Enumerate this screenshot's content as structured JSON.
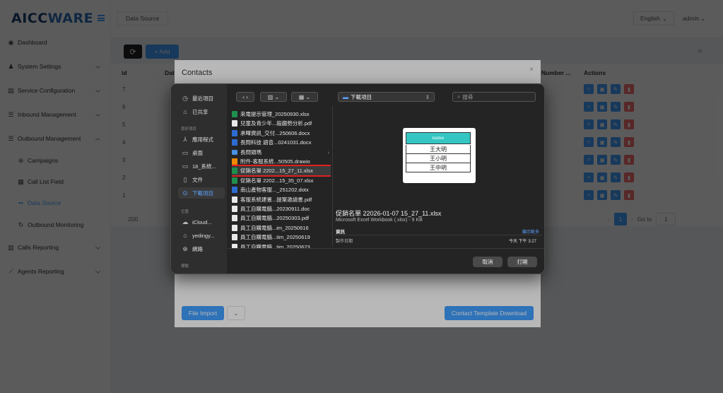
{
  "app": {
    "logo_prefix": "AICC",
    "logo_suffix": "WARE"
  },
  "sidebar": {
    "items": [
      {
        "label": "Dashboard",
        "icon": "dashboard-icon"
      },
      {
        "label": "System Settings",
        "icon": "users-icon"
      },
      {
        "label": "Service Configuration",
        "icon": "config-icon"
      },
      {
        "label": "Inbound Management",
        "icon": "inbound-icon"
      },
      {
        "label": "Outbound Management",
        "icon": "outbound-icon"
      },
      {
        "label": "Campaigns",
        "icon": "campaign-icon"
      },
      {
        "label": "Call List Field",
        "icon": "list-icon"
      },
      {
        "label": "Data Source",
        "icon": "grid-icon"
      },
      {
        "label": "Outbound Monitoring",
        "icon": "monitor-icon"
      },
      {
        "label": "Calls Reporting",
        "icon": "bar-chart-icon"
      },
      {
        "label": "Agents Reporting",
        "icon": "line-chart-icon"
      }
    ]
  },
  "header": {
    "breadcrumb_tag": "Data Source",
    "language": "English",
    "user": "admin"
  },
  "toolbar": {
    "add_label": "+ Add",
    "refresh_icon": "⟳"
  },
  "table": {
    "columns": [
      "id",
      "Dat",
      "Number ...",
      "Actions"
    ],
    "ids": [
      "7",
      "6",
      "5",
      "4",
      "3",
      "2",
      "1"
    ],
    "total": "200"
  },
  "pagination": {
    "current": "1",
    "goto_label": "Go to",
    "goto_value": "1"
  },
  "modal": {
    "title": "Contacts",
    "import_label": "File Import",
    "template_label": "Contact Template Download"
  },
  "picker": {
    "sidebar": {
      "favorites": [
        {
          "label": "最近項目",
          "icon": "clock-icon"
        },
        {
          "label": "已共享",
          "icon": "shared-folder-icon"
        }
      ],
      "heading_favorites": "喜好項目",
      "places": [
        {
          "label": "應用程式",
          "icon": "apps-icon"
        },
        {
          "label": "桌面",
          "icon": "desktop-icon"
        },
        {
          "label": "18_系統...",
          "icon": "folder-icon"
        },
        {
          "label": "文件",
          "icon": "document-icon"
        },
        {
          "label": "下載項目",
          "icon": "download-icon"
        }
      ],
      "heading_locations": "位置",
      "locations": [
        {
          "label": "iCloud...",
          "icon": "cloud-icon"
        },
        {
          "label": "yedingy...",
          "icon": "home-icon"
        },
        {
          "label": "網路",
          "icon": "globe-icon"
        }
      ],
      "heading_tags": "標籤"
    },
    "location": "下載項目",
    "search_placeholder": "搜尋",
    "files": [
      {
        "name": "來電提示管理_20250930.xlsx",
        "type": "xlsx"
      },
      {
        "name": "兒童及青少年...殺趨勢分析.pdf",
        "type": "pdf"
      },
      {
        "name": "承暉資訊_交付...250606.docx",
        "type": "docx"
      },
      {
        "name": "長問科技 語音...0241031.docx",
        "type": "docx"
      },
      {
        "name": "長問頭瑪",
        "type": "folder"
      },
      {
        "name": "附件-客服系統...50505.drawio",
        "type": "drawio"
      },
      {
        "name": "促銷名單 2202...15_27_11.xlsx",
        "type": "xlsx"
      },
      {
        "name": "促銷名單 2202...15_35_07.xlsx",
        "type": "xlsx"
      },
      {
        "name": "南山產物客服..._251202.dotx",
        "type": "dotx"
      },
      {
        "name": "客服系統建置...提案邀請書.pdf",
        "type": "pdf"
      },
      {
        "name": "員工自購電腦...20230911.doc",
        "type": "doc"
      },
      {
        "name": "員工自購電腦...20250303.pdf",
        "type": "pdf"
      },
      {
        "name": "員工自購電腦...im_20250616",
        "type": "pdf"
      },
      {
        "name": "員工自購電腦...tim_20250619",
        "type": "pdf"
      },
      {
        "name": "員工自購電腦...tim_20250623",
        "type": "pdf"
      }
    ],
    "selected_index": 6,
    "preview": {
      "header": "name",
      "rows": [
        "王大明",
        "王小明",
        "王中明"
      ]
    },
    "meta": {
      "filename": "促銷名單 22026-01-07 15_27_11.xlsx",
      "filetype": "Microsoft Excel Workbook (.xlsx) - 9 KB",
      "info_label": "資訊",
      "more_label": "顯示較多",
      "created_label": "製作日期",
      "created_value": "今天 下午 3:27"
    },
    "cancel_label": "取消",
    "open_label": "打開"
  }
}
